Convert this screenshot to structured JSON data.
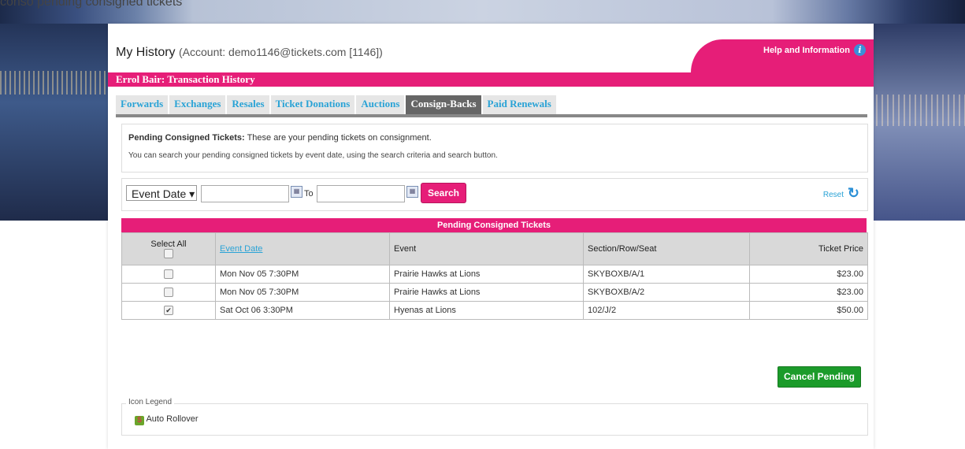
{
  "top_caption": "conso pending consigned tickets",
  "header": {
    "title": "My History",
    "account": "(Account: demo1146@tickets.com [1146])",
    "help_label": "Help and Information",
    "subtitle": "Errol Bair: Transaction History"
  },
  "tabs": [
    {
      "label": "Forwards",
      "active": false
    },
    {
      "label": "Exchanges",
      "active": false
    },
    {
      "label": "Resales",
      "active": false
    },
    {
      "label": "Ticket Donations",
      "active": false
    },
    {
      "label": "Auctions",
      "active": false
    },
    {
      "label": "Consign-Backs",
      "active": true
    },
    {
      "label": "Paid Renewals",
      "active": false
    }
  ],
  "info": {
    "heading": "Pending Consigned Tickets:",
    "line1": "These are your pending tickets on consignment.",
    "line2": "You can search your pending consigned tickets by event date, using the search criteria and search button."
  },
  "search": {
    "field_select": "Event Date",
    "from_value": "",
    "to_label": "To",
    "to_value": "",
    "search_label": "Search",
    "reset_label": "Reset"
  },
  "table": {
    "title": "Pending Consigned Tickets",
    "columns": [
      "Select All",
      "Event Date",
      "Event",
      "Section/Row/Seat",
      "Ticket Price"
    ],
    "rows": [
      {
        "checked": false,
        "event_date": "Mon Nov 05 7:30PM",
        "event": "Prairie Hawks at Lions",
        "seat": "SKYBOXB/A/1",
        "price": "$23.00"
      },
      {
        "checked": false,
        "event_date": "Mon Nov 05 7:30PM",
        "event": "Prairie Hawks at Lions",
        "seat": "SKYBOXB/A/2",
        "price": "$23.00"
      },
      {
        "checked": true,
        "event_date": "Sat Oct 06 3:30PM",
        "event": "Hyenas at Lions",
        "seat": "102/J/2",
        "price": "$50.00"
      }
    ]
  },
  "cancel_label": "Cancel Pending",
  "legend": {
    "title": "Icon Legend",
    "item_label": "Auto Rollover",
    "item_icon": "auto-rollover-icon"
  },
  "colors": {
    "accent": "#e61e78",
    "link": "#2aa3d6",
    "success": "#1b9b2a"
  }
}
